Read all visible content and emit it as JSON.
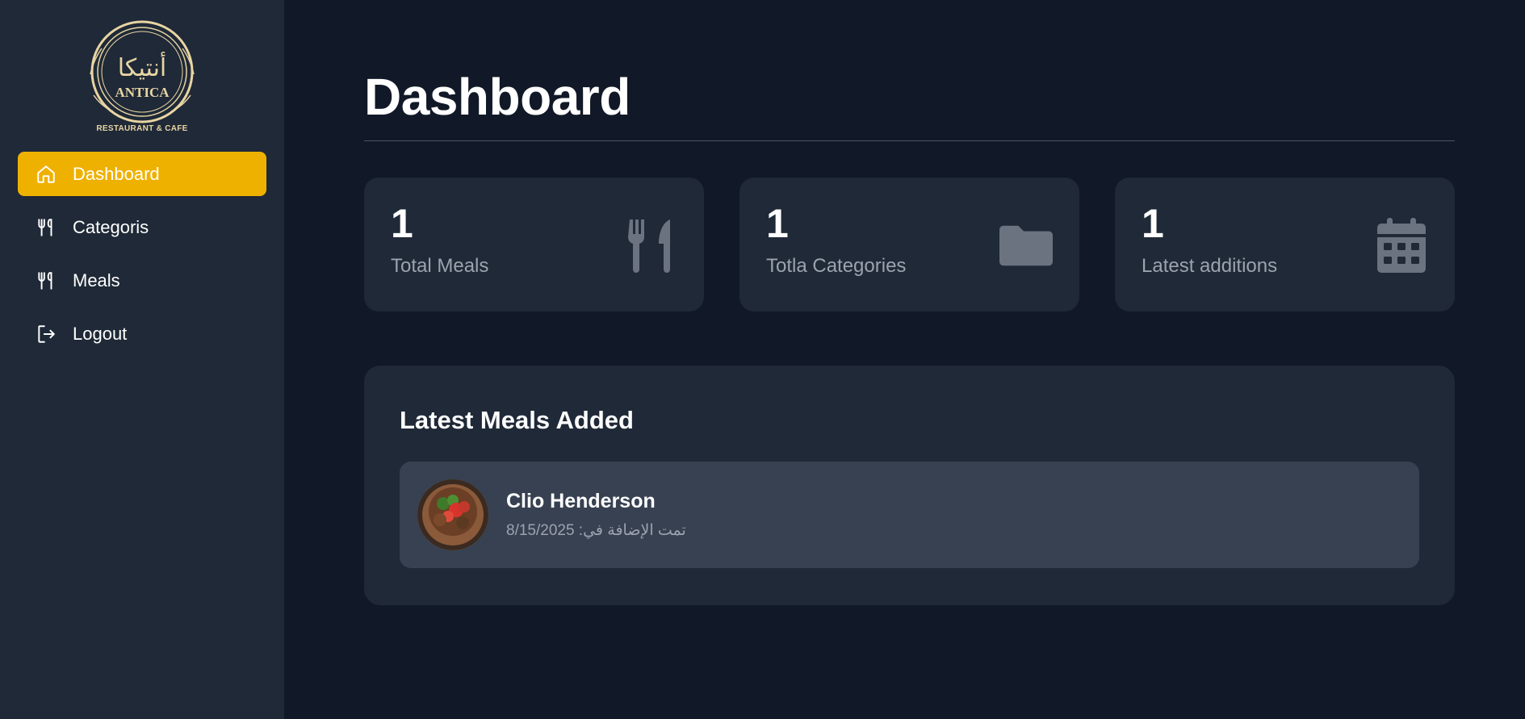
{
  "brand": {
    "arabic_name": "أنتيكا",
    "name": "ANTICA",
    "tagline": "RESTAURANT & CAFE"
  },
  "sidebar": {
    "items": [
      {
        "label": "Dashboard",
        "icon": "home-icon",
        "active": true
      },
      {
        "label": "Categoris",
        "icon": "utensils-icon",
        "active": false
      },
      {
        "label": "Meals",
        "icon": "utensils-icon",
        "active": false
      },
      {
        "label": "Logout",
        "icon": "logout-icon",
        "active": false
      }
    ]
  },
  "main": {
    "title": "Dashboard",
    "stats": [
      {
        "value": "1",
        "label": "Total Meals",
        "icon": "fork-knife-icon"
      },
      {
        "value": "1",
        "label": "Totla Categories",
        "icon": "folder-icon"
      },
      {
        "value": "1",
        "label": "Latest additions",
        "icon": "calendar-icon"
      }
    ],
    "latest": {
      "title": "Latest Meals Added",
      "items": [
        {
          "name": "Clio Henderson",
          "date_text": "تمت الإضافة في: 8/15/2025"
        }
      ]
    }
  },
  "colors": {
    "accent": "#efb100",
    "sidebar_bg": "#1f2937",
    "page_bg": "#111827",
    "card_bg": "#1f2937",
    "item_bg": "#374151",
    "muted_text": "#9ca3af",
    "icon_gray": "#6b7280"
  }
}
